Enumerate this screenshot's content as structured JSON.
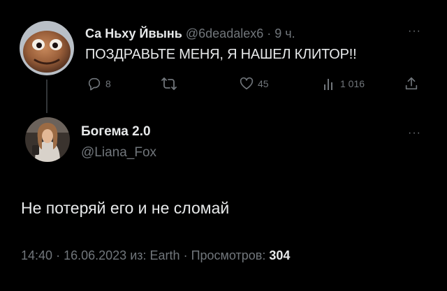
{
  "parent_tweet": {
    "author_name": "Са Ньху Йвынь",
    "author_handle": "@6deadalex6",
    "separator": "·",
    "time": "9 ч.",
    "text": "ПОЗДРАВЬТЕ МЕНЯ, Я НАШЕЛ КЛИТОР!!",
    "actions": {
      "replies": "8",
      "reposts": "",
      "likes": "45",
      "views": "1 016"
    }
  },
  "reply_tweet": {
    "author_name": "Богема 2.0",
    "author_handle": "@Liana_Fox",
    "text": "Не потеряй его и не сломай",
    "meta": {
      "time": "14:40",
      "separator": "·",
      "date": "16.06.2023",
      "source_label": "из:",
      "source": "Earth",
      "views_label": "Просмотров:",
      "views": "304"
    }
  },
  "icons": {
    "more": "more-horizontal-icon",
    "reply": "reply-bubble-icon",
    "repost": "repost-icon",
    "like": "heart-icon",
    "views": "bar-chart-icon",
    "share": "share-upload-icon"
  },
  "colors": {
    "background": "#000000",
    "primary_text": "#e7e9ea",
    "secondary_text": "#71767b",
    "thread_line": "#333639"
  }
}
